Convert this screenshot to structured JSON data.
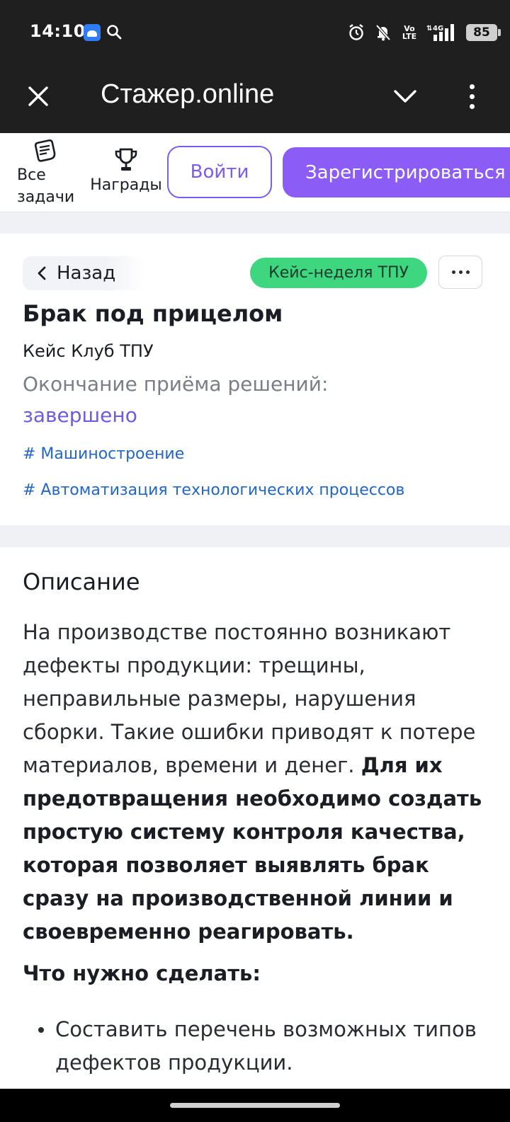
{
  "status_bar": {
    "time": "14:10",
    "battery": "85",
    "network_label": "4G",
    "volte_label": "Vo LTE",
    "icons": [
      "app-notification-icon",
      "search-icon",
      "alarm-icon",
      "mute-icon",
      "volte-icon",
      "signal-icon",
      "battery-icon"
    ]
  },
  "app_bar": {
    "title": "Стажер.online",
    "icons": [
      "close-icon",
      "chevron-down-icon",
      "more-vertical-icon"
    ]
  },
  "site_header": {
    "all_tasks_label_1": "Все",
    "all_tasks_label_2": "задачи",
    "awards_label": "Награды",
    "login_label": "Войти",
    "register_label": "Зарегистрироваться",
    "accent_color": "#8b5cf6"
  },
  "task": {
    "back_label": "Назад",
    "tag_label": "Кейс-неделя ТПУ",
    "title": "Брак под прицелом",
    "organization": "Кейс Клуб ТПУ",
    "deadline_label": "Окончание приёма решений:",
    "deadline_value": "завершено",
    "hashtags": [
      "# Машиностроение",
      "# Автоматизация технологических процессов"
    ],
    "tag_color": "#3ed67f"
  },
  "description": {
    "heading": "Описание",
    "text_plain": "На производстве постоянно возникают дефекты продукции: трещины, неправильные размеры, нарушения сборки. Такие ошибки приводят к потере материалов, времени и денег.",
    "text_bold": "Для их предотвращения необходимо создать простую систему контроля качества, которая позволяет выявлять брак сразу на производственной линии и своевременно реагировать.",
    "todo_heading": "Что нужно сделать:",
    "todo_items": [
      "Составить перечень возможных типов дефектов продукции."
    ]
  }
}
